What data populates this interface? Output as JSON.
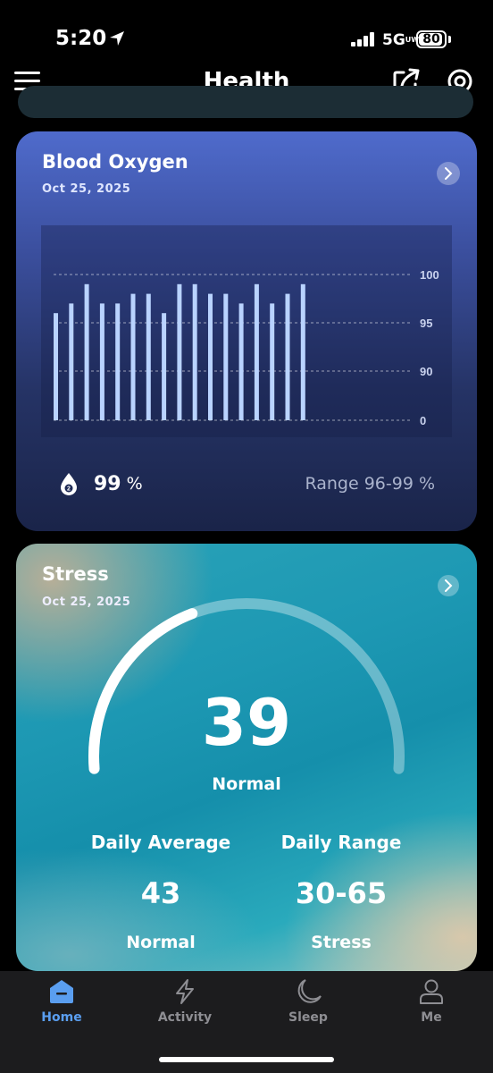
{
  "status_bar": {
    "time": "5:20",
    "network": "5G",
    "network_suffix": "UW",
    "battery": "80"
  },
  "header": {
    "title": "Health",
    "icons": [
      "menu-icon",
      "share-icon",
      "target-icon"
    ]
  },
  "blood_oxygen": {
    "title": "Blood Oxygen",
    "date": "Oct 25, 2025",
    "value": "99",
    "unit": "%",
    "range": "Range 96-99 %",
    "bar_color": "#b9d3ff"
  },
  "chart_data": {
    "type": "bar",
    "title": "",
    "y_tick_labels": [
      "100",
      "95",
      "90",
      "0"
    ],
    "y_ticks": [
      100,
      95,
      90,
      0
    ],
    "values": [
      96,
      97,
      99,
      97,
      97,
      98,
      98,
      96,
      99,
      99,
      98,
      98,
      97,
      99,
      97,
      98,
      99
    ],
    "grid": true
  },
  "stress": {
    "title": "Stress",
    "date": "Oct 25, 2025",
    "score": "39",
    "state": "Normal",
    "gauge_fraction": 0.39,
    "daily_average_label": "Daily Average",
    "daily_average_value": "43",
    "daily_average_state": "Normal",
    "daily_range_label": "Daily Range",
    "daily_range_value": "30-65",
    "daily_range_state": "Stress"
  },
  "tabs": [
    {
      "label": "Home",
      "active": true
    },
    {
      "label": "Activity",
      "active": false
    },
    {
      "label": "Sleep",
      "active": false
    },
    {
      "label": "Me",
      "active": false
    }
  ],
  "colors": {
    "accent": "#5a9ef0",
    "inactive": "#8e8e93"
  }
}
